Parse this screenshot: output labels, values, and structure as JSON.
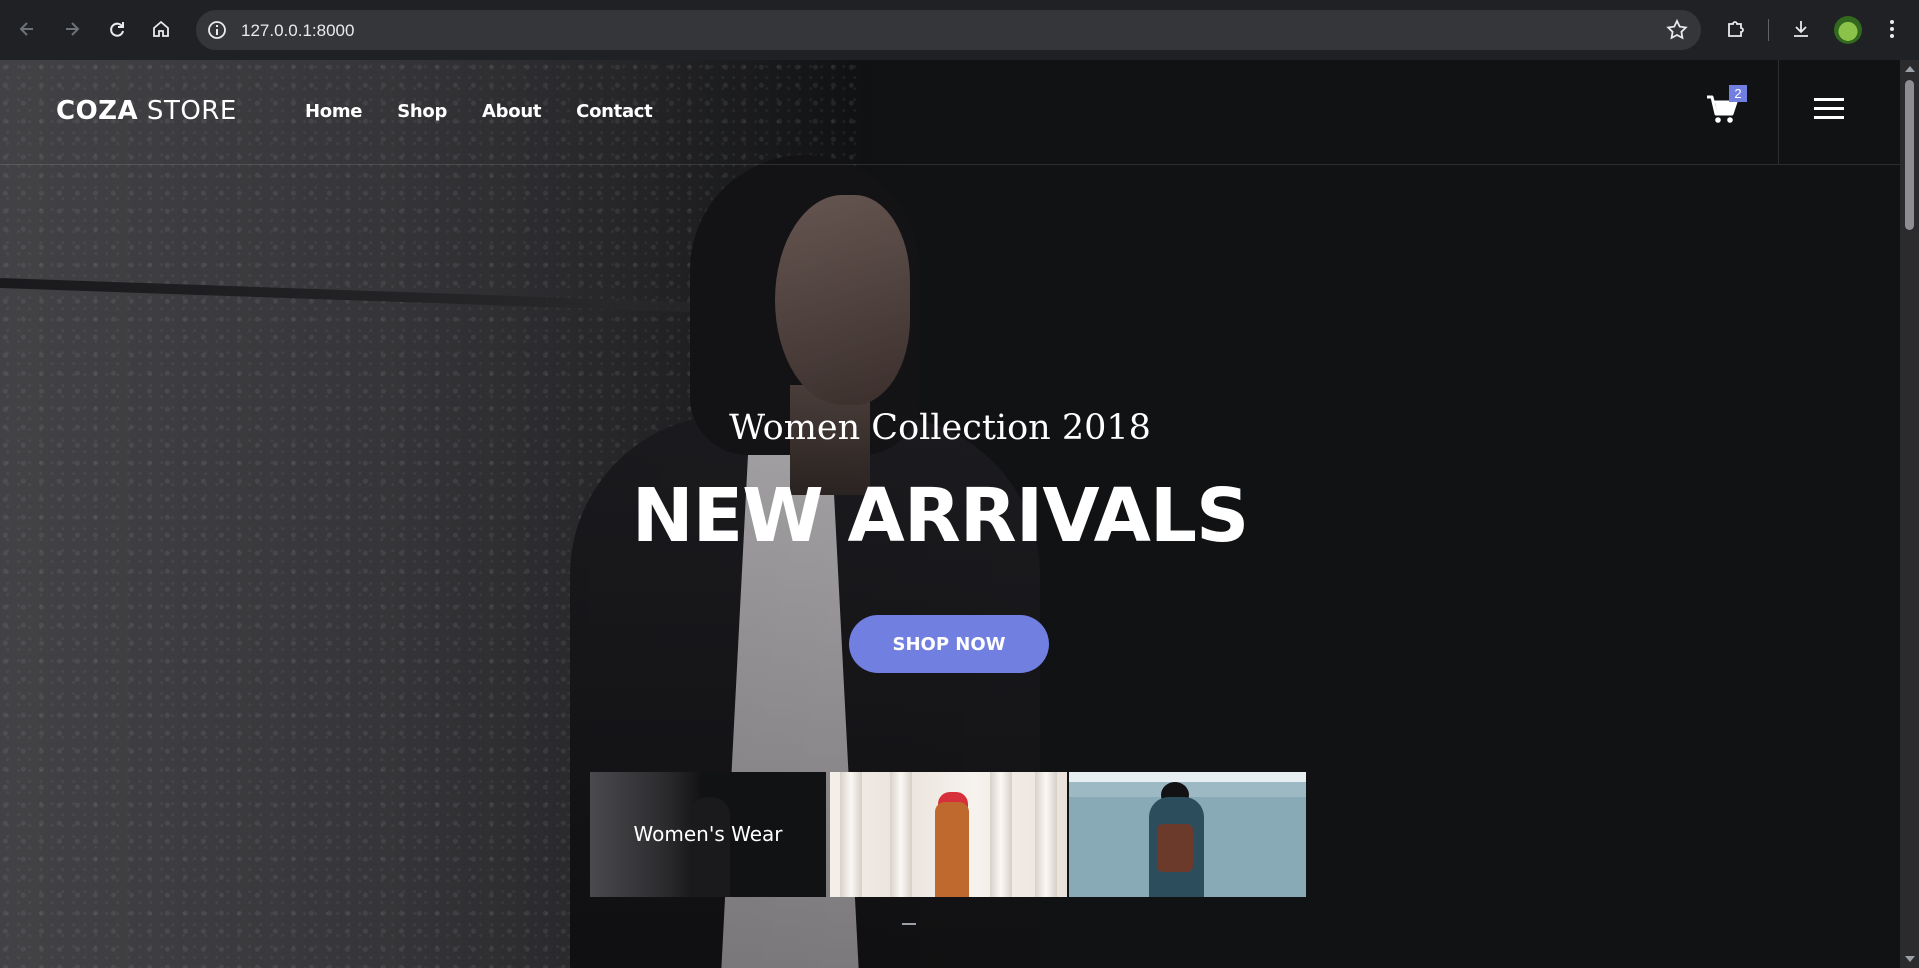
{
  "browser": {
    "url": "127.0.0.1:8000"
  },
  "header": {
    "logo_bold": "COZA",
    "logo_light": " STORE",
    "menu": [
      "Home",
      "Shop",
      "About",
      "Contact"
    ],
    "cart_count": "2"
  },
  "hero": {
    "subtitle": "Women Collection 2018",
    "title": "NEW ARRIVALS",
    "button": "SHOP NOW"
  },
  "categories": [
    {
      "label": "Women's Wear"
    }
  ],
  "colors": {
    "accent": "#717fe0",
    "background": "#111214",
    "browser_chrome": "#202124"
  },
  "icons": {
    "back": "arrow-left-icon",
    "forward": "arrow-right-icon",
    "reload": "reload-icon",
    "home": "home-icon",
    "site_info": "info-icon",
    "bookmark": "star-icon",
    "extensions": "puzzle-icon",
    "downloads": "download-icon",
    "more": "kebab-menu-icon",
    "cart": "shopping-cart-icon",
    "menu": "hamburger-icon"
  }
}
